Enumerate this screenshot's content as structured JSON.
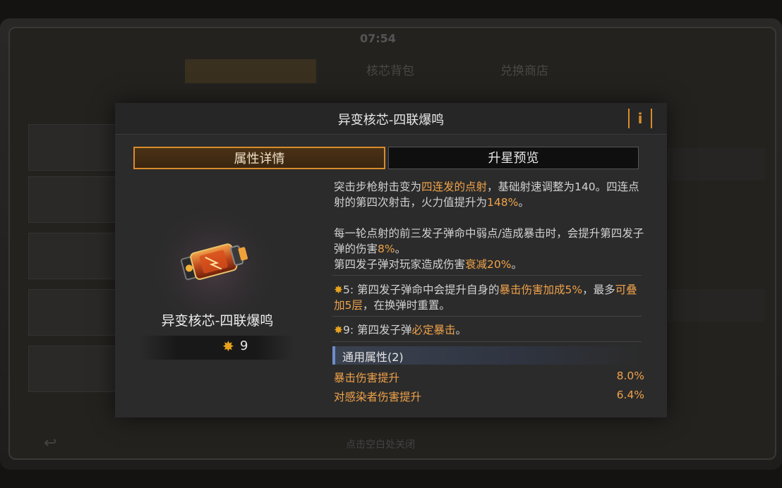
{
  "background": {
    "time": "07:54",
    "tabs": [
      "",
      "核芯背包",
      "兑换商店",
      ""
    ],
    "bottom_text": "点击空白处关闭"
  },
  "modal": {
    "title": "异变核芯-四联爆鸣",
    "info_icon": "i",
    "tabs": {
      "attributes": "属性详情",
      "star_preview": "升星预览"
    },
    "item": {
      "name": "异变核芯-四联爆鸣",
      "star_icon": "star-icon",
      "star_count": "9"
    },
    "description": {
      "p1_a": "突击步枪射击变为",
      "p1_hl": "四连发的点射",
      "p1_b": "，基础射速调整为140。四连点射的第四次射击，火力值提升为",
      "p1_hl2": "148%",
      "p1_c": "。",
      "p2_a": "每一轮点射的前三发子弹命中弱点/造成暴击时，会提升第四发子弹的伤害",
      "p2_hl": "8%",
      "p2_b": "。",
      "p3_a": "第四发子弹对玩家造成伤害",
      "p3_hl": "衰减20%",
      "p3_b": "。"
    },
    "star_effects": [
      {
        "star": "5",
        "a": ": 第四发子弹命中会提升自身的",
        "hl1": "暴击伤害加成5%",
        "b": "，最多",
        "hl2": "可叠加5层",
        "c": "，在换弹时重置。"
      },
      {
        "star": "9",
        "a": ": 第四发子弹",
        "hl1": "必定暴击",
        "b": "。"
      }
    ],
    "general_attributes": {
      "title": "通用属性(2)",
      "rows": [
        {
          "name": "暴击伤害提升",
          "value": "8.0%"
        },
        {
          "name": "对感染者伤害提升",
          "value": "6.4%"
        }
      ]
    },
    "colors": {
      "accent": "#d98b2a",
      "highlight": "#f0a24a",
      "star": "#e8a21c"
    }
  }
}
